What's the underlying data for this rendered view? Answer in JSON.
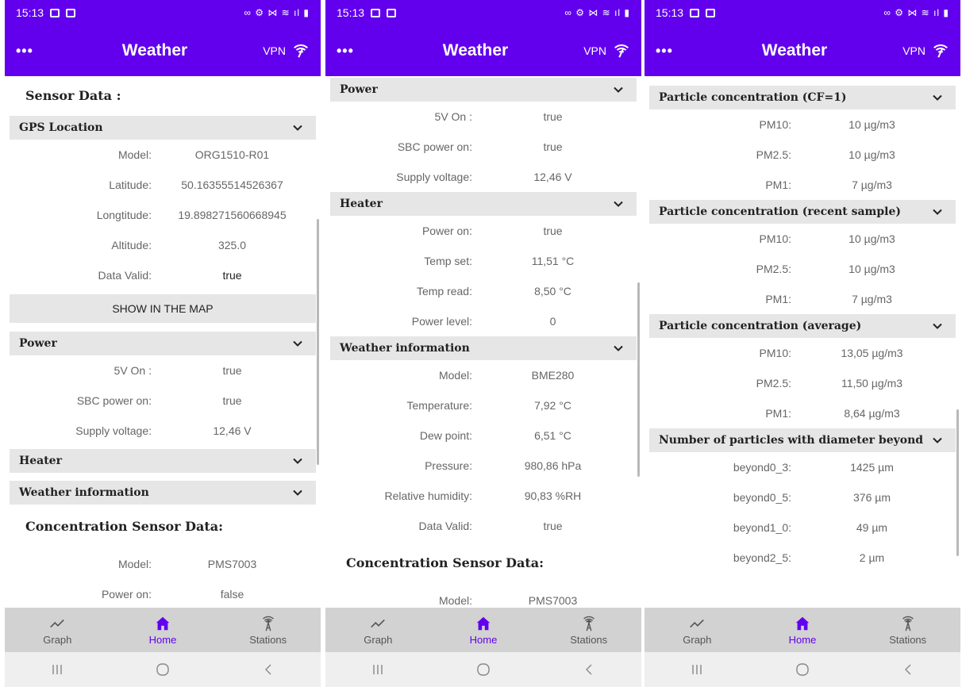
{
  "screens": [
    {
      "status": {
        "time": "15:13"
      },
      "app_bar": {
        "menu": "•••",
        "title": "Weather",
        "vpn": "VPN"
      },
      "main": {
        "sensor_title": "Sensor Data :",
        "gps": {
          "title": "GPS Location",
          "rows": [
            {
              "label": "Model:",
              "value": "ORG1510-R01"
            },
            {
              "label": "Latitude:",
              "value": "50.16355514526367"
            },
            {
              "label": "Longtitude:",
              "value": "19.898271560668945"
            },
            {
              "label": "Altitude:",
              "value": "325.0"
            },
            {
              "label": "Data Valid:",
              "value": "true"
            }
          ]
        },
        "show_map": "SHOW IN THE MAP",
        "power": {
          "title": "Power",
          "rows": [
            {
              "label": "5V On :",
              "value": "true"
            },
            {
              "label": "SBC power on:",
              "value": "true"
            },
            {
              "label": "Supply voltage:",
              "value": "12,46 V"
            }
          ]
        },
        "heater_title": "Heater",
        "weather_title": "Weather information",
        "conc_title": "Concentration Sensor Data:",
        "conc_rows": [
          {
            "label": "Model:",
            "value": "PMS7003"
          },
          {
            "label": "Power on:",
            "value": "false"
          }
        ]
      },
      "nav": {
        "graph": "Graph",
        "home": "Home",
        "stations": "Stations"
      }
    },
    {
      "status": {
        "time": "15:13"
      },
      "app_bar": {
        "menu": "•••",
        "title": "Weather",
        "vpn": "VPN"
      },
      "main": {
        "power": {
          "title": "Power",
          "rows": [
            {
              "label": "5V On :",
              "value": "true"
            },
            {
              "label": "SBC power on:",
              "value": "true"
            },
            {
              "label": "Supply voltage:",
              "value": "12,46 V"
            }
          ]
        },
        "heater": {
          "title": "Heater",
          "rows": [
            {
              "label": "Power on:",
              "value": "true"
            },
            {
              "label": "Temp set:",
              "value": "11,51 °C"
            },
            {
              "label": "Temp read:",
              "value": "8,50 °C"
            },
            {
              "label": "Power level:",
              "value": "0"
            }
          ]
        },
        "weather": {
          "title": "Weather information",
          "rows": [
            {
              "label": "Model:",
              "value": "BME280"
            },
            {
              "label": "Temperature:",
              "value": "7,92 °C"
            },
            {
              "label": "Dew point:",
              "value": "6,51 °C"
            },
            {
              "label": "Pressure:",
              "value": "980,86 hPa"
            },
            {
              "label": "Relative humidity:",
              "value": "90,83 %RH"
            },
            {
              "label": "Data Valid:",
              "value": "true"
            }
          ]
        },
        "conc_title": "Concentration Sensor Data:",
        "conc_partial": {
          "label": "Model:",
          "value": "PMS7003"
        }
      },
      "nav": {
        "graph": "Graph",
        "home": "Home",
        "stations": "Stations"
      }
    },
    {
      "status": {
        "time": "15:13"
      },
      "app_bar": {
        "menu": "•••",
        "title": "Weather",
        "vpn": "VPN"
      },
      "main": {
        "cf1": {
          "title": "Particle concentration (CF=1)",
          "rows": [
            {
              "label": "PM10:",
              "value": "10 µg/m3"
            },
            {
              "label": "PM2.5:",
              "value": "10 µg/m3"
            },
            {
              "label": "PM1:",
              "value": "7 µg/m3"
            }
          ]
        },
        "recent": {
          "title": "Particle concentration (recent sample)",
          "rows": [
            {
              "label": "PM10:",
              "value": "10 µg/m3"
            },
            {
              "label": "PM2.5:",
              "value": "10 µg/m3"
            },
            {
              "label": "PM1:",
              "value": "7 µg/m3"
            }
          ]
        },
        "average": {
          "title": "Particle concentration (average)",
          "rows": [
            {
              "label": "PM10:",
              "value": "13,05 µg/m3"
            },
            {
              "label": "PM2.5:",
              "value": "11,50 µg/m3"
            },
            {
              "label": "PM1:",
              "value": "8,64 µg/m3"
            }
          ]
        },
        "beyond": {
          "title": "Number of particles with diameter beyond",
          "rows": [
            {
              "label": "beyond0_3:",
              "value": "1425 µm"
            },
            {
              "label": "beyond0_5:",
              "value": "376 µm"
            },
            {
              "label": "beyond1_0:",
              "value": "49 µm"
            },
            {
              "label": "beyond2_5:",
              "value": "2 µm"
            }
          ]
        }
      },
      "nav": {
        "graph": "Graph",
        "home": "Home",
        "stations": "Stations"
      }
    }
  ],
  "colors": {
    "primary": "#6200ee",
    "accordion": "#e6e6e6",
    "nav_bg": "#d2d2d2"
  }
}
